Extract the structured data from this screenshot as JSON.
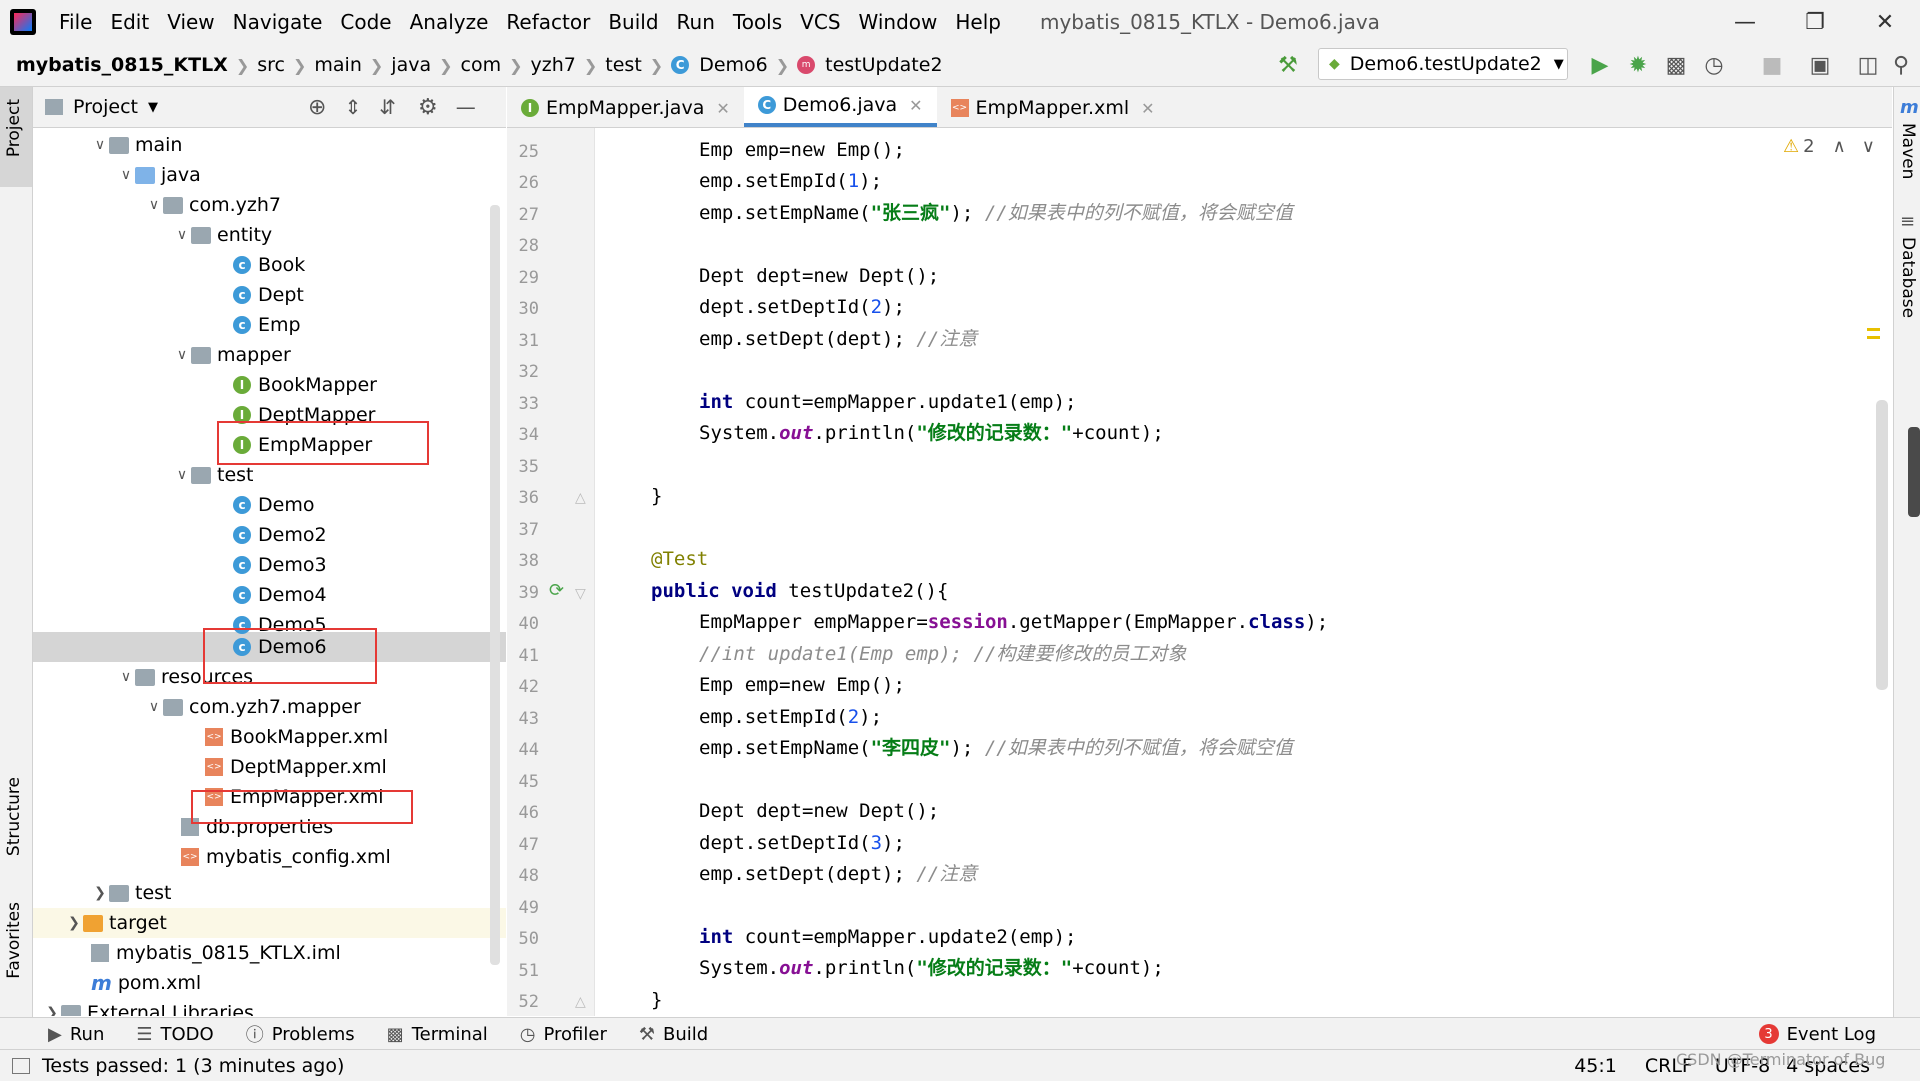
{
  "menubar": {
    "items": [
      "File",
      "Edit",
      "View",
      "Navigate",
      "Code",
      "Analyze",
      "Refactor",
      "Build",
      "Run",
      "Tools",
      "VCS",
      "Window",
      "Help"
    ],
    "title": "mybatis_0815_KTLX - Demo6.java"
  },
  "breadcrumb": [
    "mybatis_0815_KTLX",
    "src",
    "main",
    "java",
    "com",
    "yzh7",
    "test",
    "Demo6",
    "testUpdate2"
  ],
  "run_config": "Demo6.testUpdate2",
  "project_panel": {
    "title": "Project",
    "tree": [
      {
        "label": "main",
        "depth": 0
      },
      {
        "label": "java",
        "depth": 1
      },
      {
        "label": "com.yzh7",
        "depth": 2
      },
      {
        "label": "entity",
        "depth": 3
      },
      {
        "label": "Book",
        "depth": 4
      },
      {
        "label": "Dept",
        "depth": 4
      },
      {
        "label": "Emp",
        "depth": 4
      },
      {
        "label": "mapper",
        "depth": 3
      },
      {
        "label": "BookMapper",
        "depth": 4
      },
      {
        "label": "DeptMapper",
        "depth": 4
      },
      {
        "label": "EmpMapper",
        "depth": 4
      },
      {
        "label": "test",
        "depth": 3
      },
      {
        "label": "Demo",
        "depth": 4
      },
      {
        "label": "Demo2",
        "depth": 4
      },
      {
        "label": "Demo3",
        "depth": 4
      },
      {
        "label": "Demo4",
        "depth": 4
      },
      {
        "label": "Demo5",
        "depth": 4
      },
      {
        "label": "Demo6",
        "depth": 4
      },
      {
        "label": "resources",
        "depth": 1
      },
      {
        "label": "com.yzh7.mapper",
        "depth": 2
      },
      {
        "label": "BookMapper.xml",
        "depth": 3
      },
      {
        "label": "DeptMapper.xml",
        "depth": 3
      },
      {
        "label": "EmpMapper.xml",
        "depth": 3
      },
      {
        "label": "db.properties",
        "depth": 2
      },
      {
        "label": "mybatis_config.xml",
        "depth": 2
      },
      {
        "label": "test",
        "depth": 0
      },
      {
        "label": "target",
        "depth": -1
      },
      {
        "label": "mybatis_0815_KTLX.iml",
        "depth": -1
      },
      {
        "label": "pom.xml",
        "depth": -1
      },
      {
        "label": "External Libraries",
        "depth": -2
      }
    ]
  },
  "tabs": [
    "EmpMapper.java",
    "Demo6.java",
    "EmpMapper.xml"
  ],
  "editor": {
    "warnings": "2",
    "line_numbers": [
      "25",
      "26",
      "27",
      "28",
      "29",
      "30",
      "31",
      "32",
      "33",
      "34",
      "35",
      "36",
      "37",
      "38",
      "39",
      "40",
      "41",
      "42",
      "43",
      "44",
      "45",
      "46",
      "47",
      "48",
      "49",
      "50",
      "51",
      "52"
    ],
    "lines": {
      "l25": "Emp emp=new Emp();",
      "l26a": "emp.setEmpId(",
      "l26n": "1",
      "l26b": ");",
      "l27a": "emp.setEmpName(",
      "l27s": "\"张三疯\"",
      "l27b": "); ",
      "l27c": "//如果表中的列不赋值，将会赋空值",
      "l29": "Dept dept=new Dept();",
      "l30a": "dept.setDeptId(",
      "l30n": "2",
      "l30b": ");",
      "l31a": "emp.setDept(dept); ",
      "l31c": "//注意",
      "l33a": "int",
      "l33b": " count=empMapper.update1(emp);",
      "l34a": "System.",
      "l34f": "out",
      "l34b": ".println(",
      "l34s": "\"修改的记录数：\"",
      "l34c": "+count);",
      "l36": "}",
      "l38": "@Test",
      "l39a": "public void",
      "l39b": " testUpdate2(){",
      "l40a": "EmpMapper empMapper=",
      "l40f": "session",
      "l40b": ".getMapper(EmpMapper.",
      "l40k": "class",
      "l40c": ");",
      "l41": "//int update1(Emp emp); //构建要修改的员工对象",
      "l42": "Emp emp=new Emp();",
      "l43a": "emp.setEmpId(",
      "l43n": "2",
      "l43b": ");",
      "l44a": "emp.setEmpName(",
      "l44s": "\"李四皮\"",
      "l44b": "); ",
      "l44c": "//如果表中的列不赋值，将会赋空值",
      "l46": "Dept dept=new Dept();",
      "l47a": "dept.setDeptId(",
      "l47n": "3",
      "l47b": ");",
      "l48a": "emp.setDept(dept); ",
      "l48c": "//注意",
      "l50a": "int",
      "l50b": " count=empMapper.update2(emp);",
      "l51a": "System.",
      "l51f": "out",
      "l51b": ".println(",
      "l51s": "\"修改的记录数：\"",
      "l51c": "+count);",
      "l52": "}"
    }
  },
  "side_tools": {
    "left": [
      "Project",
      "Structure",
      "Favorites"
    ],
    "right": [
      "Maven",
      "Database"
    ]
  },
  "bottom_tools": [
    "Run",
    "TODO",
    "Problems",
    "Terminal",
    "Profiler",
    "Build"
  ],
  "event_log": {
    "label": "Event Log",
    "count": "3"
  },
  "status": {
    "message": "Tests passed: 1 (3 minutes ago)",
    "position": "45:1",
    "line_sep": "CRLF",
    "encoding": "UTF-8",
    "indent": "4 spaces",
    "watermark": "CSDN @Terminator of Bug"
  },
  "colors": {
    "accent": "#4083c9",
    "keyword": "#000080",
    "string": "#067d17",
    "highlight_box": "#e53935"
  }
}
